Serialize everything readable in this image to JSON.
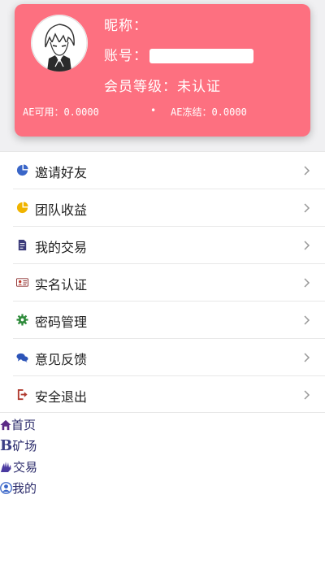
{
  "profile": {
    "nickname_label": "昵称：",
    "account_label": "账号：",
    "member_level_label": "会员等级：",
    "member_level_value": "未认证",
    "ae_available_label": "AE可用：",
    "ae_available_value": "0.0000",
    "separator": "•",
    "ae_frozen_label": "AE冻结：",
    "ae_frozen_value": "0.0000"
  },
  "menu": {
    "items": [
      {
        "label": "邀请好友",
        "icon": "pie-chart-icon"
      },
      {
        "label": "团队收益",
        "icon": "pie-chart-icon"
      },
      {
        "label": "我的交易",
        "icon": "document-icon"
      },
      {
        "label": "实名认证",
        "icon": "id-card-icon"
      },
      {
        "label": "密码管理",
        "icon": "gear-icon"
      },
      {
        "label": "意见反馈",
        "icon": "chat-bubbles-icon"
      },
      {
        "label": "安全退出",
        "icon": "logout-icon"
      }
    ]
  },
  "nav": {
    "items": [
      {
        "label": "首页",
        "icon": "home-icon"
      },
      {
        "label": "矿场",
        "icon": "bitcoin-icon",
        "icon_text": "B"
      },
      {
        "label": "交易",
        "icon": "hand-icon"
      },
      {
        "label": "我的",
        "icon": "user-icon"
      }
    ]
  },
  "colors": {
    "card": "#fd7080",
    "page_top": "#f0f0f2",
    "icon_blue": "#3a66c8",
    "icon_yellow": "#f0b400",
    "icon_green": "#2e8b3a",
    "icon_red": "#c0392b",
    "nav_text": "#2a2a6a"
  }
}
